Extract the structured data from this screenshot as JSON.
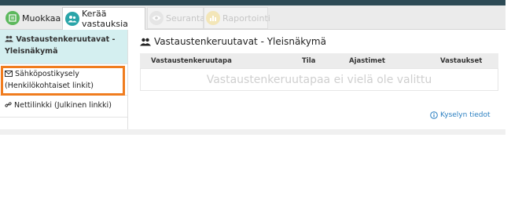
{
  "tabs": {
    "edit": "Muokkaa",
    "collect": "Kerää vastauksia",
    "follow": "Seuranta",
    "report": "Raportointi"
  },
  "sidebar": {
    "items": [
      {
        "label": "Vastaustenkeruutavat - Yleisnäkymä",
        "icon": "users-icon",
        "active": true
      },
      {
        "label": "Sähköpostikysely (Henkilökohtaiset linkit)",
        "icon": "envelope-icon",
        "highlighted": true
      },
      {
        "label": "Nettilinkki (Julkinen linkki)",
        "icon": "link-icon"
      }
    ]
  },
  "main": {
    "title": "Vastaustenkeruutavat - Yleisnäkymä",
    "columns": [
      "Vastaustenkeruutapa",
      "Tila",
      "Ajastimet",
      "Vastaukset"
    ],
    "empty_message": "Vastaustenkeruutapaa ei vielä ole valittu",
    "info_link": "Kyselyn tiedot"
  },
  "colors": {
    "accent_teal": "#2aa5a9",
    "edit_green": "#5cb85c",
    "highlight_orange": "#f07c1e",
    "link_blue": "#2a7fc1"
  }
}
